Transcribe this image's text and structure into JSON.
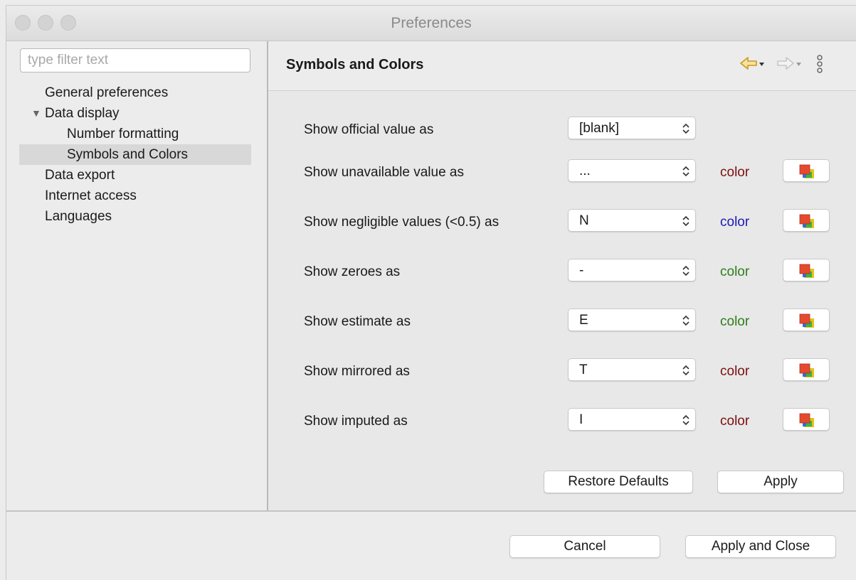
{
  "window": {
    "title": "Preferences"
  },
  "filter": {
    "placeholder": "type filter text",
    "value": ""
  },
  "tree": {
    "general": "General preferences",
    "data_display": "Data display",
    "number_formatting": "Number formatting",
    "symbols_colors": "Symbols and Colors",
    "data_export": "Data export",
    "internet_access": "Internet access",
    "languages": "Languages"
  },
  "page": {
    "title": "Symbols and Colors"
  },
  "rows": [
    {
      "label": "Show official value as",
      "value": "[blank]"
    },
    {
      "label": "Show unavailable value as",
      "value": "...",
      "color_label": "color",
      "color": "#7a1010"
    },
    {
      "label": "Show negligible values (<0.5) as",
      "value": "N",
      "color_label": "color",
      "color": "#1a1ab8"
    },
    {
      "label": "Show zeroes as",
      "value": "-",
      "color_label": "color",
      "color": "#2e7d1a"
    },
    {
      "label": "Show estimate as",
      "value": "E",
      "color_label": "color",
      "color": "#2e7d1a"
    },
    {
      "label": "Show mirrored as",
      "value": "T",
      "color_label": "color",
      "color": "#7a1010"
    },
    {
      "label": "Show imputed as",
      "value": "I",
      "color_label": "color",
      "color": "#7a1010"
    }
  ],
  "buttons": {
    "restore_defaults": "Restore Defaults",
    "apply": "Apply",
    "cancel": "Cancel",
    "apply_close": "Apply and Close"
  },
  "icons": {
    "back": "back-arrow-icon",
    "forward": "forward-arrow-icon",
    "menu": "view-menu-icon",
    "palette": "color-palette-icon"
  }
}
